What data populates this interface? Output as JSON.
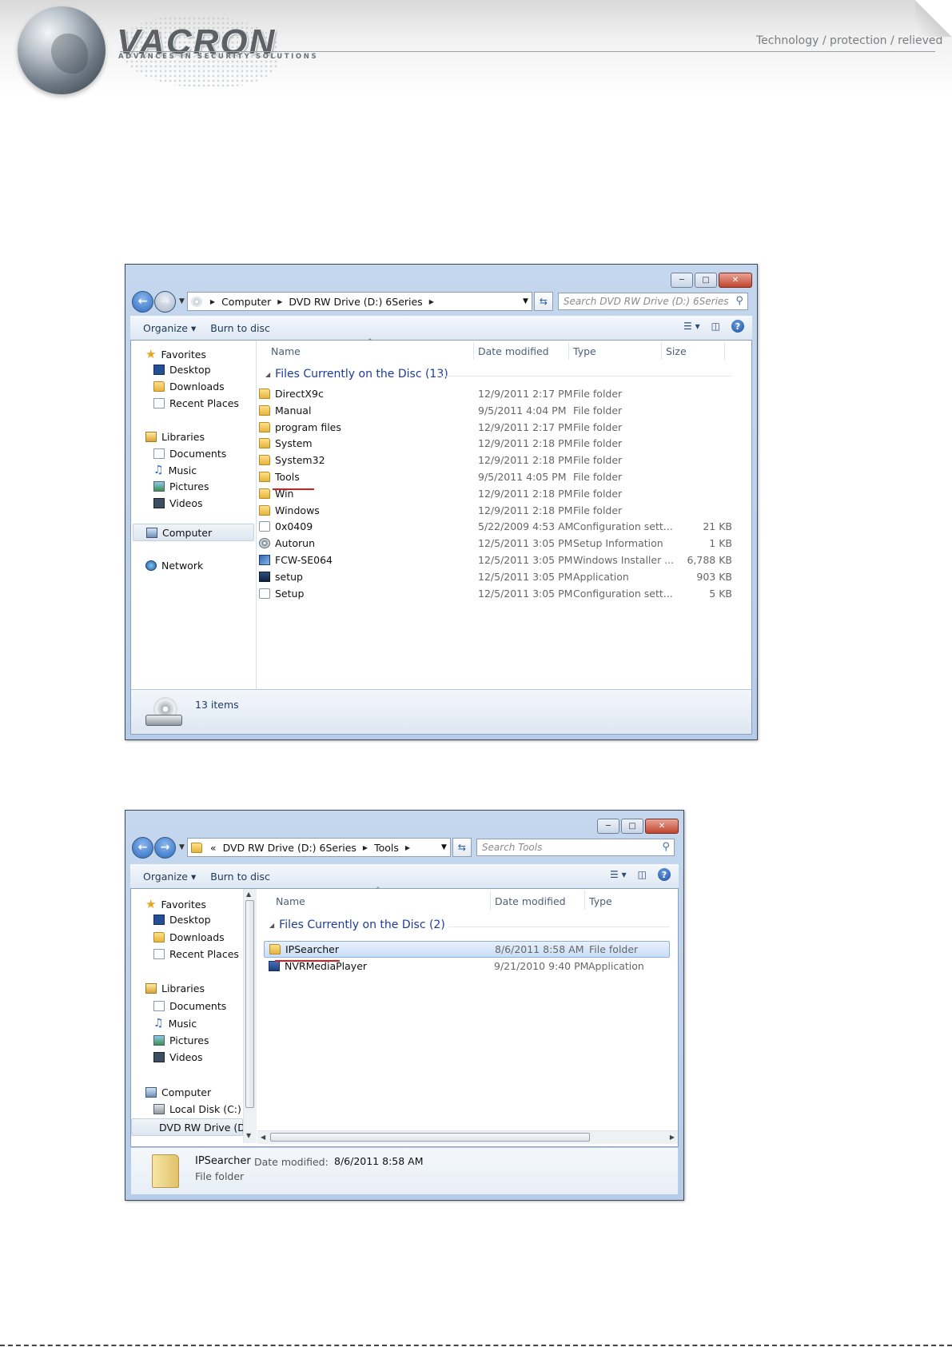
{
  "header": {
    "brand": "VACRON",
    "tagline": "ADVANCES IN SECURITY SOLUTIONS",
    "slogan": "Technology / protection / relieved"
  },
  "window1": {
    "breadcrumb": [
      "Computer",
      "DVD RW Drive (D:) 6Series"
    ],
    "search_placeholder": "Search DVD RW Drive (D:) 6Series",
    "toolbar": {
      "organize": "Organize",
      "burn": "Burn to disc"
    },
    "nav": {
      "favorites": "Favorites",
      "desktop": "Desktop",
      "downloads": "Downloads",
      "recent": "Recent Places",
      "libraries": "Libraries",
      "documents": "Documents",
      "music": "Music",
      "pictures": "Pictures",
      "videos": "Videos",
      "computer": "Computer",
      "network": "Network"
    },
    "columns": {
      "name": "Name",
      "date": "Date modified",
      "type": "Type",
      "size": "Size"
    },
    "group": "Files Currently on the Disc (13)",
    "files": [
      {
        "name": "DirectX9c",
        "date": "12/9/2011 2:17 PM",
        "type": "File folder",
        "size": "",
        "icon": "folder-icon"
      },
      {
        "name": "Manual",
        "date": "9/5/2011 4:04 PM",
        "type": "File folder",
        "size": "",
        "icon": "folder-icon"
      },
      {
        "name": "program files",
        "date": "12/9/2011 2:17 PM",
        "type": "File folder",
        "size": "",
        "icon": "folder-icon"
      },
      {
        "name": "System",
        "date": "12/9/2011 2:18 PM",
        "type": "File folder",
        "size": "",
        "icon": "folder-icon"
      },
      {
        "name": "System32",
        "date": "12/9/2011 2:18 PM",
        "type": "File folder",
        "size": "",
        "icon": "folder-icon"
      },
      {
        "name": "Tools",
        "date": "9/5/2011 4:05 PM",
        "type": "File folder",
        "size": "",
        "icon": "folder-icon"
      },
      {
        "name": "Win",
        "date": "12/9/2011 2:18 PM",
        "type": "File folder",
        "size": "",
        "icon": "folder-icon"
      },
      {
        "name": "Windows",
        "date": "12/9/2011 2:18 PM",
        "type": "File folder",
        "size": "",
        "icon": "folder-icon"
      },
      {
        "name": "0x0409",
        "date": "5/22/2009 4:53 AM",
        "type": "Configuration sett...",
        "size": "21 KB",
        "icon": "settings-file-icon"
      },
      {
        "name": "Autorun",
        "date": "12/5/2011 3:05 PM",
        "type": "Setup Information",
        "size": "1 KB",
        "icon": "setup-info-icon"
      },
      {
        "name": "FCW-SE064",
        "date": "12/5/2011 3:05 PM",
        "type": "Windows Installer ...",
        "size": "6,788 KB",
        "icon": "installer-icon"
      },
      {
        "name": "setup",
        "date": "12/5/2011 3:05 PM",
        "type": "Application",
        "size": "903 KB",
        "icon": "application-icon"
      },
      {
        "name": "Setup",
        "date": "12/5/2011 3:05 PM",
        "type": "Configuration sett...",
        "size": "5 KB",
        "icon": "settings-file-icon"
      }
    ],
    "status": "13 items"
  },
  "window2": {
    "breadcrumb_prefix": "«",
    "breadcrumb": [
      "DVD RW Drive (D:) 6Series",
      "Tools"
    ],
    "search_placeholder": "Search Tools",
    "toolbar": {
      "organize": "Organize",
      "burn": "Burn to disc"
    },
    "nav": {
      "favorites": "Favorites",
      "desktop": "Desktop",
      "downloads": "Downloads",
      "recent": "Recent Places",
      "libraries": "Libraries",
      "documents": "Documents",
      "music": "Music",
      "pictures": "Pictures",
      "videos": "Videos",
      "computer": "Computer",
      "local_disk": "Local Disk (C:)",
      "dvd": "DVD RW Drive (D"
    },
    "columns": {
      "name": "Name",
      "date": "Date modified",
      "type": "Type"
    },
    "group": "Files Currently on the Disc (2)",
    "files": [
      {
        "name": "IPSearcher",
        "date": "8/6/2011 8:58 AM",
        "type": "File folder",
        "icon": "folder-icon"
      },
      {
        "name": "NVRMediaPlayer",
        "date": "9/21/2010 9:40 PM",
        "type": "Application",
        "icon": "nvr-app-icon"
      }
    ],
    "details": {
      "name": "IPSearcher",
      "date_label": "Date modified:",
      "date": "8/6/2011 8:58 AM",
      "type": "File folder"
    }
  },
  "colors": {
    "accent_blue": "#1e3c96",
    "highlight_red": "#d61e1e",
    "frame": "#bed3ea"
  }
}
